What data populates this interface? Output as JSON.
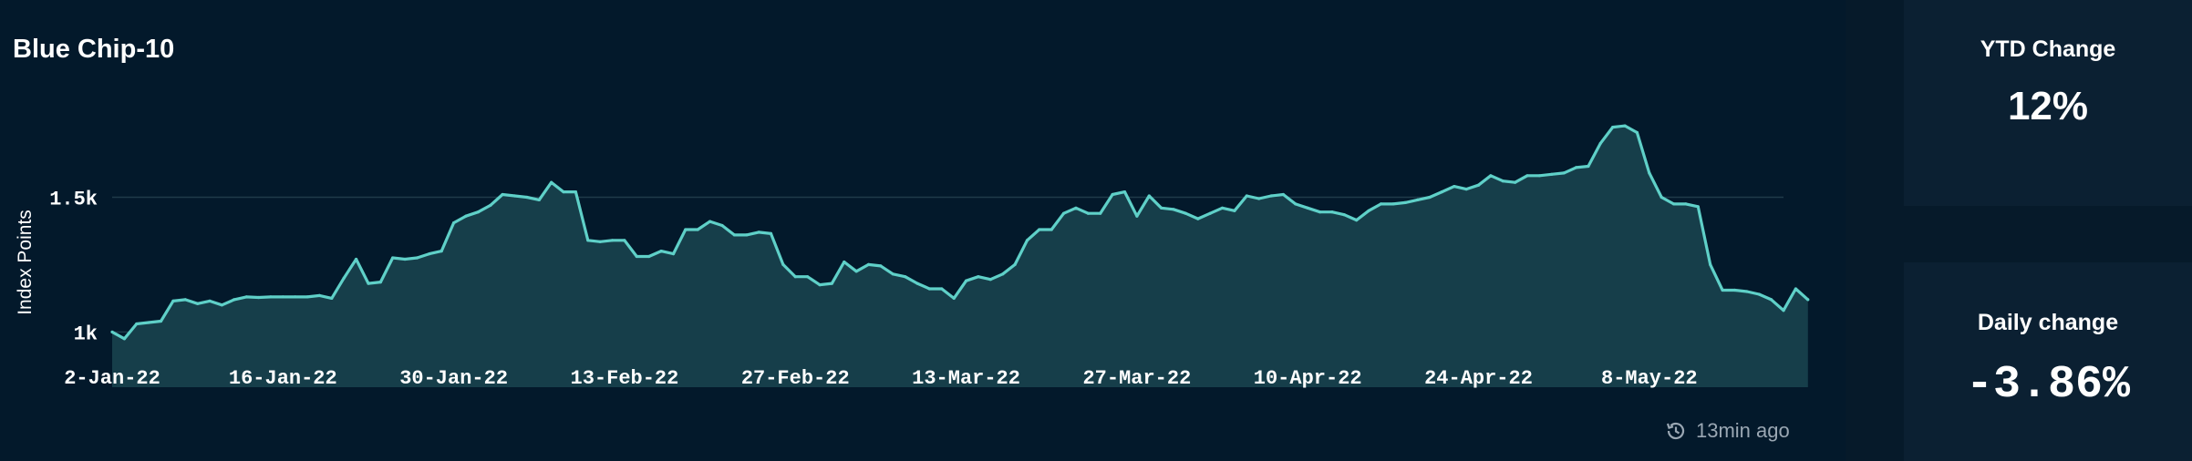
{
  "title": "Blue Chip-10",
  "updated": {
    "icon": "history-clock-icon",
    "text": "13min ago"
  },
  "cards": [
    {
      "label": "YTD Change",
      "value": "12%"
    },
    {
      "label": "Daily change",
      "value": "-3.86%"
    }
  ],
  "colors": {
    "background": "#03192b",
    "line": "#5fd0c8",
    "area": "#163e4a",
    "card": "#0b2032",
    "text": "#ffffff",
    "muted": "#9aa7b3"
  },
  "chart_data": {
    "type": "area",
    "ylabel": "Index Points",
    "xlabel": "",
    "y_ticks": [
      {
        "value": 1000,
        "label": "1k"
      },
      {
        "value": 1500,
        "label": "1.5k"
      }
    ],
    "x_ticks": [
      {
        "day": 0,
        "label": "2-Jan-22"
      },
      {
        "day": 14,
        "label": "16-Jan-22"
      },
      {
        "day": 28,
        "label": "30-Jan-22"
      },
      {
        "day": 42,
        "label": "13-Feb-22"
      },
      {
        "day": 56,
        "label": "27-Feb-22"
      },
      {
        "day": 70,
        "label": "13-Mar-22"
      },
      {
        "day": 84,
        "label": "27-Mar-22"
      },
      {
        "day": 98,
        "label": "10-Apr-22"
      },
      {
        "day": 112,
        "label": "24-Apr-22"
      },
      {
        "day": 126,
        "label": "8-May-22"
      }
    ],
    "ylim": [
      795,
      1860
    ],
    "xlim": [
      0,
      137
    ],
    "grid": true,
    "values": [
      1000,
      975,
      1030,
      1035,
      1040,
      1115,
      1120,
      1105,
      1115,
      1100,
      1120,
      1130,
      1128,
      1130,
      1130,
      1130,
      1130,
      1135,
      1125,
      1200,
      1270,
      1180,
      1185,
      1275,
      1270,
      1275,
      1290,
      1300,
      1405,
      1430,
      1445,
      1470,
      1510,
      1505,
      1500,
      1490,
      1555,
      1520,
      1520,
      1340,
      1335,
      1340,
      1340,
      1280,
      1280,
      1300,
      1290,
      1380,
      1380,
      1410,
      1395,
      1360,
      1360,
      1370,
      1365,
      1250,
      1205,
      1205,
      1175,
      1180,
      1260,
      1225,
      1250,
      1245,
      1215,
      1205,
      1180,
      1160,
      1160,
      1125,
      1190,
      1205,
      1195,
      1215,
      1250,
      1340,
      1380,
      1380,
      1440,
      1460,
      1440,
      1440,
      1510,
      1520,
      1430,
      1505,
      1460,
      1455,
      1440,
      1420,
      1440,
      1460,
      1450,
      1505,
      1495,
      1505,
      1510,
      1475,
      1460,
      1445,
      1445,
      1435,
      1415,
      1450,
      1475,
      1475,
      1480,
      1490,
      1500,
      1520,
      1540,
      1530,
      1545,
      1580,
      1560,
      1555,
      1580,
      1580,
      1585,
      1590,
      1610,
      1615,
      1700,
      1760,
      1765,
      1740,
      1590,
      1500,
      1475,
      1475,
      1465,
      1250,
      1155,
      1155,
      1150,
      1140,
      1120,
      1080,
      1160,
      1120
    ]
  }
}
